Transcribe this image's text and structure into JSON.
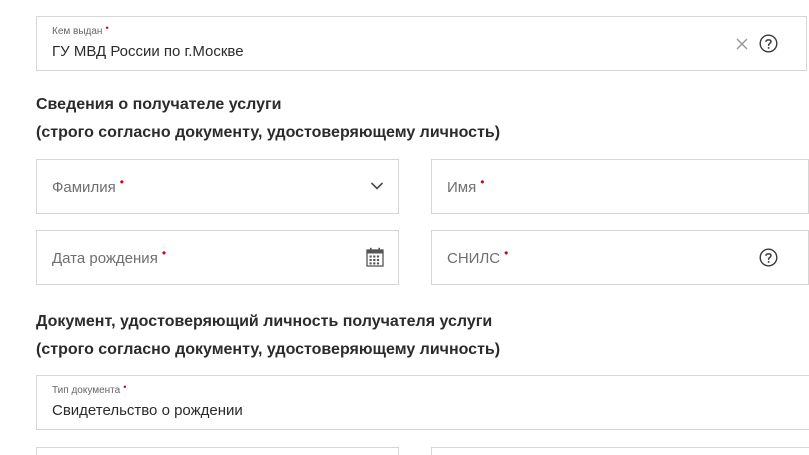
{
  "issued_by": {
    "label": "Кем выдан",
    "required_mark": "•",
    "value": "ГУ МВД России по г.Москве",
    "clear_icon": "close-icon",
    "help_icon": "question-circle-icon"
  },
  "recipient_section": {
    "title_line1": "Сведения о получателе услуги",
    "title_line2": "(строго согласно документу, удостоверяющему личность)"
  },
  "fields": {
    "surname": {
      "placeholder": "Фамилия",
      "required_mark": "•",
      "icon": "chevron-down-icon"
    },
    "name": {
      "placeholder": "Имя",
      "required_mark": "•"
    },
    "birth_date": {
      "placeholder": "Дата рождения",
      "required_mark": "•",
      "icon": "calendar-icon"
    },
    "snils": {
      "placeholder": "СНИЛС",
      "required_mark": "•",
      "icon": "question-circle-icon"
    }
  },
  "document_section": {
    "title_line1": "Документ, удостоверяющий личность получателя услуги",
    "title_line2": "(строго согласно документу, удостоверяющему личность)"
  },
  "document_type": {
    "label": "Тип документа",
    "required_mark": "•",
    "value": "Свидетельство о рождении"
  },
  "colors": {
    "required": "#d0021b",
    "border": "#d6d6d6",
    "text": "#2b2b2b",
    "placeholder": "#6f6f6f"
  }
}
